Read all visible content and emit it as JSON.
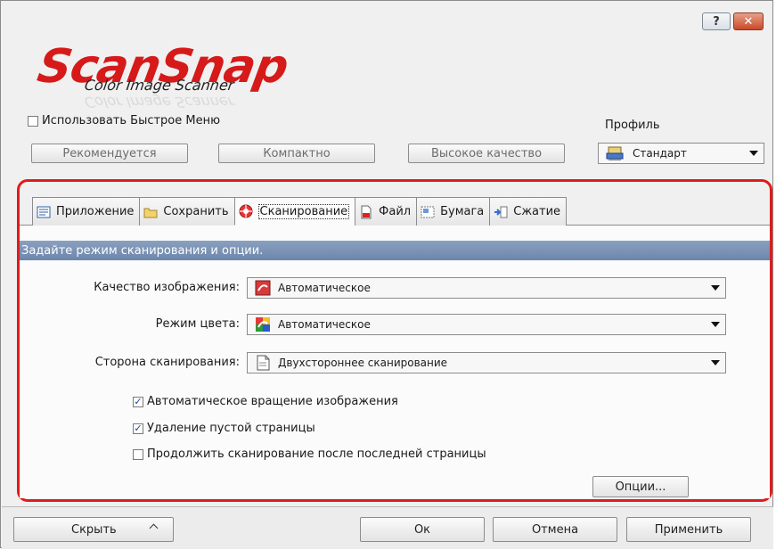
{
  "window": {
    "help_glyph": "?",
    "close_glyph": "✕"
  },
  "logo": {
    "main": "ScanSnap",
    "sub": "Color Image Scanner"
  },
  "quick_menu": {
    "label": "Использовать Быстрое Меню",
    "checked": false
  },
  "presets": {
    "recommended": "Рекомендуется",
    "compact": "Компактно",
    "high_quality": "Высокое качество"
  },
  "profile": {
    "label": "Профиль",
    "value": "Стандарт",
    "icon": "profile-icon"
  },
  "tabs": [
    {
      "label": "Приложение",
      "icon": "application-icon",
      "active": false
    },
    {
      "label": "Сохранить",
      "icon": "folder-icon",
      "active": false
    },
    {
      "label": "Сканирование",
      "icon": "scanning-icon",
      "active": true
    },
    {
      "label": "Файл",
      "icon": "file-icon",
      "active": false
    },
    {
      "label": "Бумага",
      "icon": "paper-icon",
      "active": false
    },
    {
      "label": "Сжатие",
      "icon": "compression-icon",
      "active": false
    }
  ],
  "scan": {
    "header": "Задайте режим сканирования и опции.",
    "quality_label": "Качество изображения:",
    "quality_value": "Автоматическое",
    "color_label": "Режим цвета:",
    "color_value": "Автоматическое",
    "side_label": "Сторона сканирования:",
    "side_value": "Двухстороннее сканирование",
    "auto_rotate_label": "Автоматическое вращение изображения",
    "auto_rotate_checked": true,
    "blank_page_label": "Удаление пустой страницы",
    "blank_page_checked": true,
    "continue_label": "Продолжить сканирование после последней страницы",
    "continue_checked": false,
    "options_button": "Опции..."
  },
  "footer": {
    "hide": "Скрыть",
    "ok": "Ок",
    "cancel": "Отмена",
    "apply": "Применить"
  },
  "colors": {
    "accent_red": "#e01b1b",
    "section_bar": "#7a92b5"
  }
}
